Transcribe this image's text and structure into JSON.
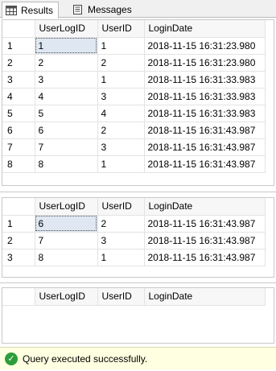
{
  "tabs": [
    {
      "label": "Results",
      "icon": "grid-icon",
      "active": true
    },
    {
      "label": "Messages",
      "icon": "messages-icon",
      "active": false
    }
  ],
  "results": [
    {
      "columns": [
        "UserLogID",
        "UserID",
        "LoginDate"
      ],
      "rows": [
        {
          "n": "1",
          "cells": [
            "1",
            "1",
            "2018-11-15 16:31:23.980"
          ]
        },
        {
          "n": "2",
          "cells": [
            "2",
            "2",
            "2018-11-15 16:31:23.980"
          ]
        },
        {
          "n": "3",
          "cells": [
            "3",
            "1",
            "2018-11-15 16:31:33.983"
          ]
        },
        {
          "n": "4",
          "cells": [
            "4",
            "3",
            "2018-11-15 16:31:33.983"
          ]
        },
        {
          "n": "5",
          "cells": [
            "5",
            "4",
            "2018-11-15 16:31:33.983"
          ]
        },
        {
          "n": "6",
          "cells": [
            "6",
            "2",
            "2018-11-15 16:31:43.987"
          ]
        },
        {
          "n": "7",
          "cells": [
            "7",
            "3",
            "2018-11-15 16:31:43.987"
          ]
        },
        {
          "n": "8",
          "cells": [
            "8",
            "1",
            "2018-11-15 16:31:43.987"
          ]
        }
      ]
    },
    {
      "columns": [
        "UserLogID",
        "UserID",
        "LoginDate"
      ],
      "rows": [
        {
          "n": "1",
          "cells": [
            "6",
            "2",
            "2018-11-15 16:31:43.987"
          ]
        },
        {
          "n": "2",
          "cells": [
            "7",
            "3",
            "2018-11-15 16:31:43.987"
          ]
        },
        {
          "n": "3",
          "cells": [
            "8",
            "1",
            "2018-11-15 16:31:43.987"
          ]
        }
      ]
    },
    {
      "columns": [
        "UserLogID",
        "UserID",
        "LoginDate"
      ],
      "rows": []
    }
  ],
  "status": {
    "text": "Query executed successfully.",
    "icon": "checkmark-icon",
    "color": "#2e9c3a",
    "background": "#ffffe1"
  }
}
